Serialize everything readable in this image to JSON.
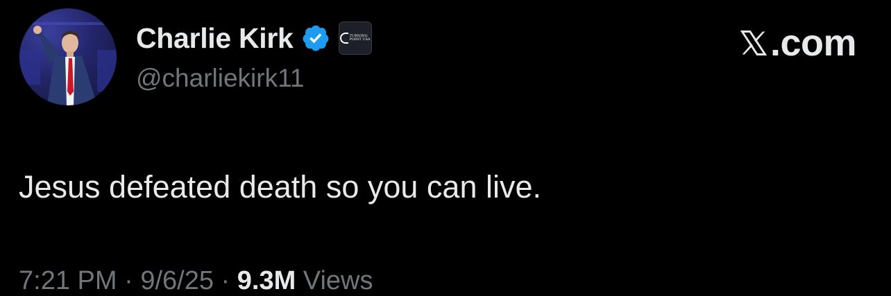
{
  "author": {
    "display_name": "Charlie Kirk",
    "handle": "@charliekirk11",
    "verified": true,
    "verified_icon": "verified-badge-icon",
    "affiliate_badge": {
      "icon": "turning-point-usa-logo",
      "text": "TURNING\nPOINT USA"
    },
    "avatar": "profile-photo"
  },
  "site": {
    "icon": "x-logo-icon",
    "text": ".com"
  },
  "tweet": {
    "text": "Jesus defeated death so you can live.",
    "time": "7:21 PM",
    "separator": "·",
    "date": "9/6/25",
    "views_count": "9.3M",
    "views_label": "Views"
  },
  "colors": {
    "background": "#000000",
    "primary_text": "#e7e9ea",
    "secondary_text": "#71767b",
    "verified_blue": "#1d9bf0"
  }
}
